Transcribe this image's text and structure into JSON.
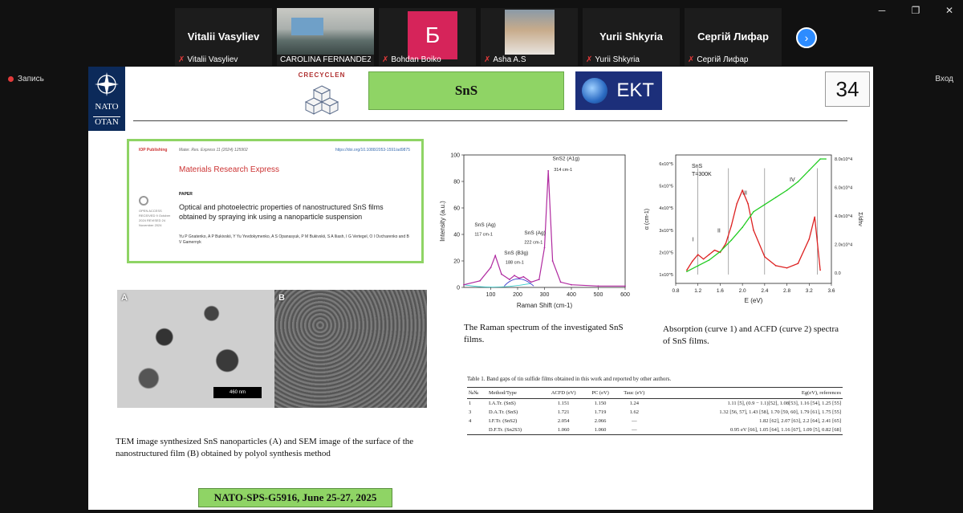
{
  "window": {
    "minimize": "─",
    "restore": "❐",
    "close": "✕"
  },
  "participants": [
    {
      "big_name": "Vitalii Vasyliev",
      "label": "Vitalii Vasyliev",
      "type": "name"
    },
    {
      "big_name": "",
      "label": "CAROLINA FERNANDEZ S...",
      "type": "video-room"
    },
    {
      "big_name": "Б",
      "label": "Bohdan Boiko",
      "type": "letter",
      "color": "#d6245a"
    },
    {
      "big_name": "",
      "label": "Asha A.S",
      "type": "video-person"
    },
    {
      "big_name": "Yurii Shkyria",
      "label": "Yurii Shkyria",
      "type": "name"
    },
    {
      "big_name": "Сергій Лифар",
      "label": "Сергій Лифар",
      "type": "name"
    }
  ],
  "icons": {
    "mic_off": "mic-off-icon",
    "next": "chevron-right-icon",
    "record": "record-dot-icon"
  },
  "record_label": "Запись",
  "exit_label": "Вход",
  "slide": {
    "nato_line1": "NATO",
    "nato_line2": "OTAN",
    "crecycle_text": "CRECYCLEN",
    "title": "SnS",
    "ekt_text": "EKT",
    "page_number": "34",
    "paper": {
      "publisher": "IOP Publishing",
      "journal_ref": "Mater. Res. Express 11 (2024) 125902",
      "doi": "https://doi.org/10.1088/2053-1591/ad9875",
      "journal": "Materials Research Express",
      "type": "PAPER",
      "title": "Optical and photoelectric properties of nanostructured SnS films obtained by spraying ink using a nanoparticle suspension",
      "authors": "Yu P Gnatenko, A P Bukivskii, Y Yu Yevdokymenko, A S Opanasyuk, P M Bukivskii, S A Iliash, I G Vertegel, O I Ovcharenko and B V Gamernyk",
      "side_info": "OPEN ACCESS  RECEIVED 9 October 2024  REVISED 24 November 2024"
    },
    "tem_label_a": "A",
    "tem_label_b": "B",
    "scale_bar": "460 nm",
    "tem_caption": "TEM image synthesized SnS nanoparticles (A) and SEM image of the surface of the nanostructured film (B) obtained by polyol synthesis method",
    "raman_caption": "The Raman spectrum of the investigated SnS films.",
    "absorb_caption": "Absorption (curve 1) and ACFD (curve 2) spectra of SnS films.",
    "table": {
      "caption": "Table 1. Band gaps of tin sulfide films obtained in this work and reported by other authors.",
      "headers": [
        "№№",
        "Method/Type",
        "ACFD (eV)",
        "PC (eV)",
        "Tauc (eV)",
        "Eg(eV), references"
      ],
      "rows": [
        [
          "1",
          "I.A.Tr. (SnS)",
          "1.151",
          "1.150",
          "1.24",
          "1.11 [5], (0.9 − 1.1)[52], 1.08[53], 1.16 [54], 1.25 [55]"
        ],
        [
          "3",
          "D.A.Tr. (SnS)",
          "1.721",
          "1.719",
          "1.62",
          "1.32 [56, 57], 1.43 [58], 1.70 [59, 60], 1.79 [61], 1.75 [55]"
        ],
        [
          "4",
          "I.F.Tr. (SnS2)",
          "2.054",
          "2.066",
          "—",
          "1.82 [62], 2.07 [63], 2.2 [64], 2.41 [65]"
        ],
        [
          "",
          "D.F.Tr. (Sn2S3)",
          "1.060",
          "1.060",
          "—",
          "0.95 eV [66], 1.05 [64], 1.16 [67], 1.09 [5], 0.82 [68]"
        ]
      ]
    },
    "footer": "NATO-SPS-G5916, June 25-27, 2025"
  },
  "chart_data": [
    {
      "type": "line",
      "xlabel": "Raman Shift (cm-1)",
      "ylabel": "Intensity (a.u.)",
      "xlim": [
        0,
        600
      ],
      "ylim": [
        0,
        100
      ],
      "x_ticks": [
        "100",
        "200",
        "300",
        "400",
        "500",
        "600"
      ],
      "y_ticks": [
        "0",
        "20",
        "40",
        "60",
        "80",
        "100"
      ],
      "annotations": [
        "SnS2 (A1g)",
        "314 cm-1",
        "SnS (Ag)",
        "117 cm-1",
        "SnS (B3g)",
        "188 cm-1",
        "SnS (Ag)",
        "222 cm-1"
      ],
      "series": [
        {
          "x": [
            0,
            60,
            100,
            117,
            140,
            170,
            188,
            205,
            222,
            250,
            280,
            300,
            314,
            330,
            360,
            400,
            500,
            600
          ],
          "y": [
            2,
            5,
            15,
            24,
            10,
            6,
            9,
            7,
            8,
            4,
            6,
            30,
            88,
            20,
            4,
            2,
            1,
            1
          ]
        }
      ]
    },
    {
      "type": "line",
      "title": "SnS  T=300K",
      "xlabel": "E (eV)",
      "ylabel": "α (cm-1)",
      "ylabel_right": "Σ/dhν",
      "xlim": [
        0.8,
        3.6
      ],
      "x_ticks": [
        "0.8",
        "1.2",
        "1.6",
        "2.0",
        "2.4",
        "2.8",
        "3.2",
        "3.6"
      ],
      "y_ticks_left": [
        "1x10^5",
        "2x10^5",
        "3x10^5",
        "4x10^5",
        "5x10^5",
        "6x10^5"
      ],
      "y_ticks_right": [
        "0.0",
        "2.0x10^4",
        "4.0x10^4",
        "6.0x10^4",
        "8.0x10^4"
      ],
      "regions": [
        "I",
        "II",
        "III",
        "IV"
      ],
      "series": [
        {
          "name": "1",
          "color": "#d22",
          "x": [
            1.0,
            1.1,
            1.2,
            1.3,
            1.4,
            1.5,
            1.6,
            1.7,
            1.8,
            1.9,
            2.0,
            2.1,
            2.2,
            2.4,
            2.6,
            2.8,
            3.0,
            3.2,
            3.3,
            3.4
          ],
          "y": [
            1.2,
            1.6,
            1.9,
            1.7,
            1.9,
            2.1,
            2.0,
            2.4,
            3.2,
            4.2,
            4.8,
            4.2,
            3.0,
            1.8,
            1.4,
            1.3,
            1.5,
            2.6,
            3.6,
            1.2
          ]
        },
        {
          "name": "2",
          "color": "#2c2",
          "x": [
            1.0,
            1.2,
            1.4,
            1.6,
            1.8,
            2.0,
            2.2,
            2.4,
            2.6,
            2.8,
            3.0,
            3.2,
            3.4,
            3.5
          ],
          "y": [
            0.1,
            0.5,
            0.9,
            1.5,
            2.3,
            3.2,
            4.3,
            4.8,
            5.3,
            5.8,
            6.4,
            7.2,
            8.0,
            8.0
          ]
        }
      ]
    }
  ]
}
